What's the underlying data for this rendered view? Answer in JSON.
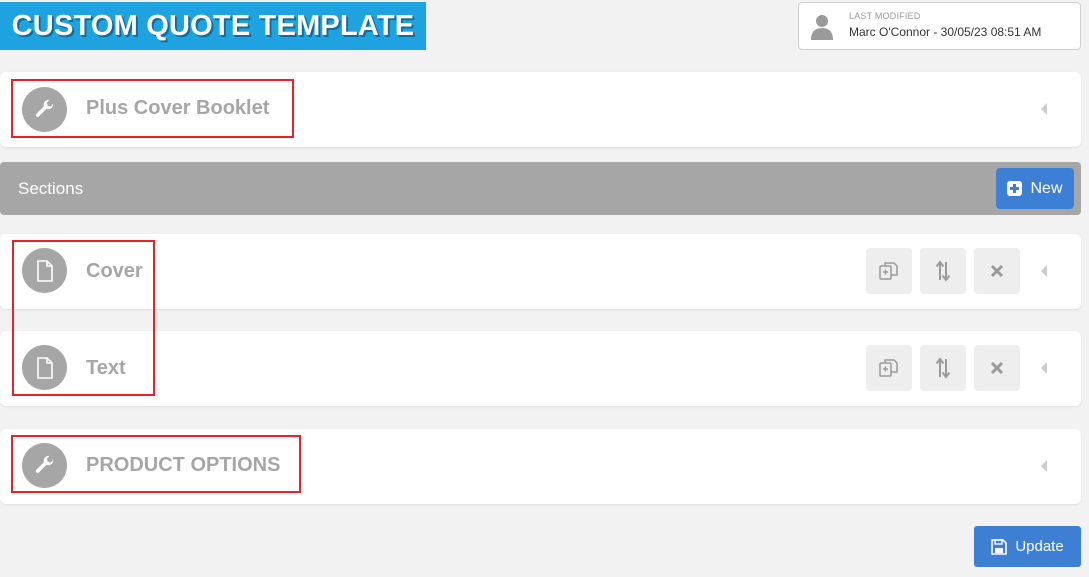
{
  "header": {
    "title": "CUSTOM QUOTE TEMPLATE",
    "last_modified_label": "LAST MODIFIED",
    "last_modified_value": "Marc O'Connor - 30/05/23 08:51 AM"
  },
  "top_card": {
    "title": "Plus Cover Booklet",
    "icon": "wrench-icon"
  },
  "sections": {
    "label": "Sections",
    "new_button_label": "New",
    "items": [
      {
        "title": "Cover",
        "icon": "document-icon"
      },
      {
        "title": "Text",
        "icon": "document-icon"
      }
    ]
  },
  "product_options": {
    "title": "PRODUCT OPTIONS",
    "icon": "wrench-icon"
  },
  "footer": {
    "update_button_label": "Update"
  },
  "colors": {
    "banner": "#1ea3e0",
    "primary_button": "#3d7fd4",
    "sections_bar": "#a6a6a6",
    "highlight_box": "#e8212d"
  }
}
